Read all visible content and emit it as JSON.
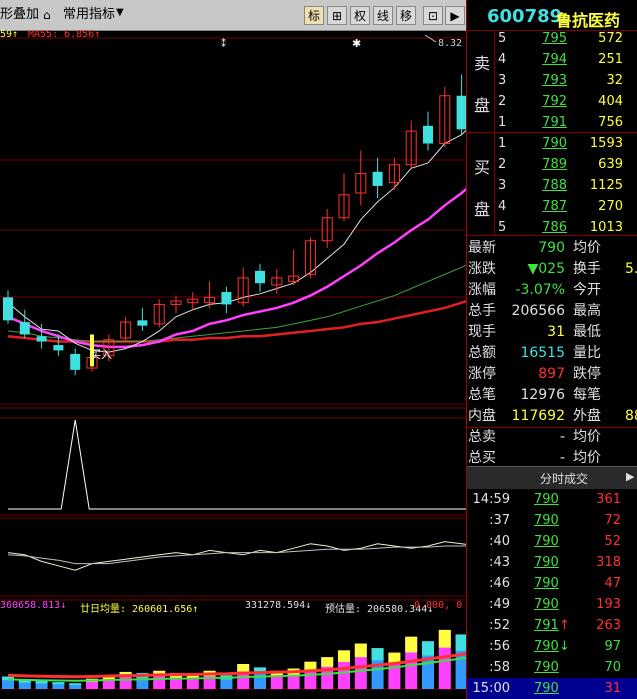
{
  "toolbar": {
    "overlay_label": "形叠加",
    "indicator_label": "常用指标",
    "buttons": [
      "标",
      "⊞",
      "权",
      "线",
      "移"
    ]
  },
  "ma_legend": {
    "ma_a": "59↑",
    "ma_b": "MA55: 6.856↑"
  },
  "price_marker": "8.32",
  "buy_signal": "买入",
  "volume_legend": {
    "v1": "360658.813↓",
    "v2": "廿日均量: 260601.656↑",
    "v3": "331278.594↓",
    "v4": "预估量: 206580.344↓",
    "v5": "0.000, 0"
  },
  "stock": {
    "code": "600789",
    "name": "鲁抗医药"
  },
  "order_book": {
    "sell_caption_top": "卖",
    "sell_caption_bottom": "盘",
    "buy_caption_top": "买",
    "buy_caption_bottom": "盘",
    "sell": [
      {
        "level": "5",
        "price": "795",
        "volume": "572"
      },
      {
        "level": "4",
        "price": "794",
        "volume": "251"
      },
      {
        "level": "3",
        "price": "793",
        "volume": "32"
      },
      {
        "level": "2",
        "price": "792",
        "volume": "404"
      },
      {
        "level": "1",
        "price": "791",
        "volume": "756"
      }
    ],
    "buy": [
      {
        "level": "1",
        "price": "790",
        "volume": "1593"
      },
      {
        "level": "2",
        "price": "789",
        "volume": "639"
      },
      {
        "level": "3",
        "price": "788",
        "volume": "1125"
      },
      {
        "level": "4",
        "price": "787",
        "volume": "270"
      },
      {
        "level": "5",
        "price": "786",
        "volume": "1013"
      }
    ]
  },
  "stats": [
    {
      "label": "最新",
      "value": "790",
      "label2": "均价",
      "value2": ""
    },
    {
      "label": "涨跌",
      "value": "▼025",
      "label2": "换手",
      "value2": "5."
    },
    {
      "label": "涨幅",
      "value": "-3.07%",
      "label2": "今开",
      "value2": ""
    },
    {
      "label": "总手",
      "value": "206566",
      "label2": "最高",
      "value2": ""
    },
    {
      "label": "现手",
      "value": "31",
      "label2": "最低",
      "value2": ""
    },
    {
      "label": "总额",
      "value": "16515",
      "label2": "量比",
      "value2": ""
    },
    {
      "label": "涨停",
      "value": "897",
      "label2": "跌停",
      "value2": ""
    },
    {
      "label": "总笔",
      "value": "12976",
      "label2": "每笔",
      "value2": ""
    },
    {
      "label": "内盘",
      "value": "117692",
      "label2": "外盘",
      "value2": "88"
    },
    {
      "label": "总卖",
      "value": "-",
      "label2": "均价",
      "value2": ""
    },
    {
      "label": "总买",
      "value": "-",
      "label2": "均价",
      "value2": ""
    }
  ],
  "ticks_header": "分时成交",
  "ticks": [
    {
      "time": "14:59",
      "price": "790",
      "arrow": "",
      "volume": "361"
    },
    {
      "time": ":37",
      "price": "790",
      "arrow": "",
      "volume": "72"
    },
    {
      "time": ":40",
      "price": "790",
      "arrow": "",
      "volume": "52"
    },
    {
      "time": ":43",
      "price": "790",
      "arrow": "",
      "volume": "318"
    },
    {
      "time": ":46",
      "price": "790",
      "arrow": "",
      "volume": "47"
    },
    {
      "time": ":49",
      "price": "790",
      "arrow": "",
      "volume": "193"
    },
    {
      "time": ":52",
      "price": "791",
      "arrow": "↑",
      "volume": "263"
    },
    {
      "time": ":56",
      "price": "790",
      "arrow": "↓",
      "volume": "97"
    },
    {
      "time": ":58",
      "price": "790",
      "arrow": "",
      "volume": "70"
    },
    {
      "time": "15:00",
      "price": "790",
      "arrow": "",
      "volume": "31"
    }
  ],
  "colors": {
    "up": "#ff3030",
    "down": "#40e0e0",
    "green": "#40e040",
    "yellow": "#ffff40",
    "magenta": "#ff40ff",
    "ma20": "#40a040",
    "ma55": "#e02020"
  },
  "chart_data": {
    "type": "candlestick",
    "candles": [
      {
        "o": 6.99,
        "c": 6.86,
        "h": 7.03,
        "l": 6.84
      },
      {
        "o": 6.85,
        "c": 6.78,
        "h": 6.92,
        "l": 6.76
      },
      {
        "o": 6.77,
        "c": 6.74,
        "h": 6.84,
        "l": 6.7
      },
      {
        "o": 6.72,
        "c": 6.69,
        "h": 6.78,
        "l": 6.66
      },
      {
        "o": 6.67,
        "c": 6.58,
        "h": 6.7,
        "l": 6.55
      },
      {
        "o": 6.59,
        "c": 6.65,
        "h": 6.7,
        "l": 6.57
      },
      {
        "o": 6.66,
        "c": 6.75,
        "h": 6.78,
        "l": 6.63
      },
      {
        "o": 6.76,
        "c": 6.85,
        "h": 6.88,
        "l": 6.74
      },
      {
        "o": 6.86,
        "c": 6.83,
        "h": 6.93,
        "l": 6.8
      },
      {
        "o": 6.84,
        "c": 6.95,
        "h": 6.98,
        "l": 6.82
      },
      {
        "o": 6.95,
        "c": 6.97,
        "h": 7.0,
        "l": 6.9
      },
      {
        "o": 6.96,
        "c": 6.98,
        "h": 7.02,
        "l": 6.92
      },
      {
        "o": 6.96,
        "c": 6.99,
        "h": 7.08,
        "l": 6.93
      },
      {
        "o": 7.02,
        "c": 6.95,
        "h": 7.05,
        "l": 6.9
      },
      {
        "o": 6.96,
        "c": 7.1,
        "h": 7.16,
        "l": 6.94
      },
      {
        "o": 7.14,
        "c": 7.07,
        "h": 7.18,
        "l": 7.02
      },
      {
        "o": 7.06,
        "c": 7.1,
        "h": 7.15,
        "l": 7.01
      },
      {
        "o": 7.08,
        "c": 7.11,
        "h": 7.26,
        "l": 7.06
      },
      {
        "o": 7.12,
        "c": 7.31,
        "h": 7.33,
        "l": 7.1
      },
      {
        "o": 7.31,
        "c": 7.44,
        "h": 7.49,
        "l": 7.27
      },
      {
        "o": 7.44,
        "c": 7.57,
        "h": 7.69,
        "l": 7.42
      },
      {
        "o": 7.58,
        "c": 7.69,
        "h": 7.82,
        "l": 7.51
      },
      {
        "o": 7.7,
        "c": 7.62,
        "h": 7.78,
        "l": 7.55
      },
      {
        "o": 7.64,
        "c": 7.74,
        "h": 7.78,
        "l": 7.6
      },
      {
        "o": 7.74,
        "c": 7.93,
        "h": 7.99,
        "l": 7.72
      },
      {
        "o": 7.96,
        "c": 7.86,
        "h": 8.04,
        "l": 7.82
      },
      {
        "o": 7.86,
        "c": 8.13,
        "h": 8.18,
        "l": 7.84
      },
      {
        "o": 8.13,
        "c": 7.94,
        "h": 8.25,
        "l": 7.91
      },
      {
        "o": 7.99,
        "c": 8.21,
        "h": 8.25,
        "l": 7.96
      },
      {
        "o": 8.21,
        "c": 8.06,
        "h": 8.28,
        "l": 7.86
      },
      {
        "o": 8.08,
        "c": 8.23,
        "h": 8.28,
        "l": 8.0
      },
      {
        "o": 8.22,
        "c": 8.12,
        "h": 8.32,
        "l": 8.12
      },
      {
        "o": 8.15,
        "c": 8.01,
        "h": 8.24,
        "l": 7.99
      }
    ],
    "ma5": [
      6.96,
      6.88,
      6.81,
      6.8,
      6.73,
      6.69,
      6.68,
      6.7,
      6.74,
      6.8,
      6.88,
      6.92,
      6.95,
      6.96,
      6.99,
      7.01,
      7.04,
      7.07,
      7.13,
      7.21,
      7.29,
      7.43,
      7.53,
      7.61,
      7.72,
      7.75,
      7.86,
      7.91,
      8.0,
      8.07,
      8.11,
      8.14,
      8.13
    ],
    "ma10": [
      6.88,
      6.84,
      6.8,
      6.77,
      6.74,
      6.72,
      6.71,
      6.71,
      6.72,
      6.74,
      6.78,
      6.8,
      6.84,
      6.86,
      6.89,
      6.91,
      6.93,
      6.96,
      7.0,
      7.05,
      7.11,
      7.17,
      7.24,
      7.3,
      7.37,
      7.43,
      7.51,
      7.58,
      7.66,
      7.72,
      7.79,
      7.85,
      7.89
    ],
    "ma20": [
      6.8,
      6.79,
      6.77,
      6.76,
      6.75,
      6.74,
      6.74,
      6.74,
      6.74,
      6.75,
      6.76,
      6.77,
      6.78,
      6.79,
      6.8,
      6.81,
      6.82,
      6.84,
      6.86,
      6.88,
      6.91,
      6.94,
      6.97,
      7.0,
      7.04,
      7.08,
      7.12,
      7.16,
      7.21,
      7.25,
      7.3,
      7.35,
      7.4
    ],
    "ma55": [
      6.77,
      6.76,
      6.75,
      6.74,
      6.74,
      6.74,
      6.74,
      6.74,
      6.74,
      6.74,
      6.75,
      6.75,
      6.76,
      6.76,
      6.77,
      6.77,
      6.78,
      6.79,
      6.8,
      6.81,
      6.82,
      6.84,
      6.85,
      6.87,
      6.89,
      6.91,
      6.93,
      6.96,
      6.99,
      7.02,
      7.05,
      7.08,
      7.1
    ],
    "volume": [
      55,
      40,
      35,
      30,
      25,
      45,
      60,
      75,
      70,
      80,
      70,
      65,
      80,
      60,
      110,
      95,
      80,
      90,
      120,
      140,
      170,
      200,
      180,
      160,
      230,
      210,
      260,
      240,
      300,
      320,
      270,
      220,
      180
    ],
    "volume_ma": [
      60,
      58,
      56,
      55,
      54,
      55,
      57,
      59,
      60,
      62,
      63,
      64,
      66,
      67,
      70,
      72,
      74,
      76,
      80,
      84,
      90,
      98,
      105,
      112,
      122,
      132,
      142,
      152,
      166,
      180,
      190,
      198,
      204
    ],
    "indicator_a": [
      0,
      0,
      0,
      0,
      0,
      0,
      0,
      0,
      0,
      0,
      0,
      0,
      0,
      0,
      0,
      0,
      0,
      0,
      0,
      0,
      0,
      0,
      0,
      0,
      0,
      0,
      0,
      0,
      0,
      0,
      0,
      0,
      0
    ],
    "indicator_a_spike_index": 4,
    "indicator_b": [
      0.2,
      0.1,
      -0.2,
      -0.4,
      -0.6,
      -0.3,
      -0.2,
      -0.1,
      0.0,
      0.1,
      0.2,
      0.1,
      0.3,
      0.2,
      0.1,
      0.3,
      0.2,
      0.4,
      0.6,
      0.5,
      0.3,
      0.4,
      0.6,
      0.5,
      0.4,
      0.5,
      0.7,
      0.6,
      0.5,
      0.6,
      0.4,
      0.5,
      0.4
    ],
    "indicator_b2": [
      0.1,
      0.05,
      -0.05,
      -0.15,
      -0.3,
      -0.3,
      -0.3,
      -0.2,
      -0.1,
      0.0,
      0.05,
      0.1,
      0.15,
      0.2,
      0.2,
      0.2,
      0.2,
      0.25,
      0.3,
      0.35,
      0.35,
      0.35,
      0.4,
      0.45,
      0.45,
      0.45,
      0.5,
      0.5,
      0.5,
      0.5,
      0.5,
      0.5,
      0.45
    ],
    "ylim": [
      6.5,
      8.4
    ]
  }
}
